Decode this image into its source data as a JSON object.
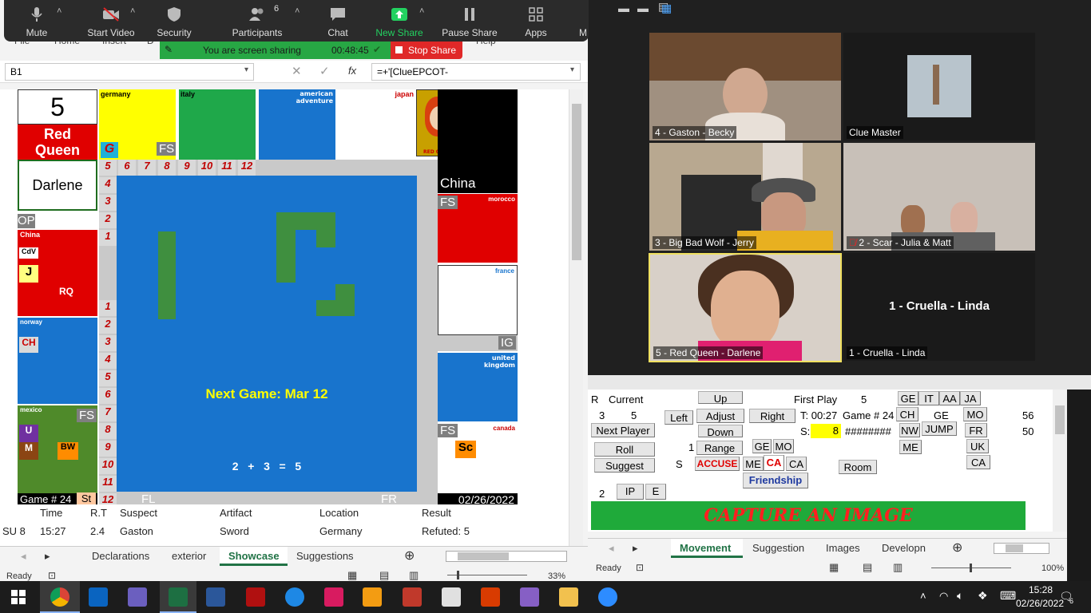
{
  "zoom_toolbar": {
    "buttons": [
      {
        "label": "Mute"
      },
      {
        "label": "Start Video"
      },
      {
        "label": "Security"
      },
      {
        "label": "Participants",
        "count": "6"
      },
      {
        "label": "Chat"
      },
      {
        "label": "New Share"
      },
      {
        "label": "Pause Share"
      },
      {
        "label": "Apps"
      },
      {
        "label": "M"
      }
    ],
    "sharing_text": "You are screen sharing",
    "sharing_time": "00:48:45",
    "stop_share": "Stop Share"
  },
  "excel_left": {
    "menu": [
      "File",
      "Home",
      "Insert",
      "D",
      "Help"
    ],
    "name_box": "B1",
    "formula": "=+'[ClueEPCOT-",
    "board": {
      "die_value": "5",
      "player_name_1": "Red",
      "player_name_2": "Queen",
      "darlene": "Darlene",
      "rooms": {
        "germany": "germany",
        "italy": "italy",
        "american_adventure_1": "american",
        "american_adventure_2": "adventure",
        "japan": "japan",
        "china": "China",
        "china_small": "China",
        "morocco": "morocco",
        "france": "france",
        "norway": "norway",
        "mexico": "mexico",
        "united_1": "united",
        "united_2": "kingdom",
        "canada": "canada"
      },
      "fs": "FS",
      "op": "OP",
      "ig": "IG",
      "fl": "FL",
      "fr": "FR",
      "st": "St",
      "cdv": "CdV",
      "j": "J",
      "rq": "RQ",
      "ch": "CH",
      "u": "U",
      "m": "M",
      "bw": "BW",
      "sc": "Sc",
      "g": "G",
      "top_nums": [
        "5",
        "6",
        "7",
        "8",
        "9",
        "10",
        "11",
        "12"
      ],
      "left_nums": [
        "4",
        "3",
        "2",
        "1",
        "",
        "",
        "1",
        "2",
        "3",
        "4",
        "5",
        "6",
        "7",
        "8",
        "9",
        "10",
        "11",
        "12"
      ],
      "next_game": "Next Game: Mar 12",
      "dice_sum": "2   +   3   =   5",
      "game_no": "Game # 24",
      "date": "02/26/2022",
      "card_caption": "RED QUEEN"
    },
    "table": {
      "headers": [
        "Time",
        "R.T",
        "Suspect",
        "Artifact",
        "Location",
        "Result"
      ],
      "row": [
        "SU 8",
        "15:27",
        "2.4",
        "Gaston",
        "Sword",
        "Germany",
        "Refuted: 5"
      ]
    },
    "tabs": [
      "Declarations",
      "exterior",
      "Showcase",
      "Suggestions"
    ],
    "active_tab": "Showcase",
    "status": "Ready",
    "zoom": "33%"
  },
  "zoom_gallery": {
    "tiles": [
      {
        "name": "4 - Gaston - Becky"
      },
      {
        "name": "Clue Master"
      },
      {
        "name": "3 - Big Bad Wolf - Jerry"
      },
      {
        "name": "2 - Scar - Julia & Matt"
      },
      {
        "name": "5 - Red Queen - Darlene"
      },
      {
        "name": "1 - Cruella - Linda",
        "center": "1 - Cruella - Linda"
      }
    ]
  },
  "excel_right": {
    "labels": {
      "r": "R",
      "current": "Current",
      "first_play": "First Play",
      "fp_val": "5",
      "v3": "3",
      "v5": "5",
      "t_label": "T: 00:27",
      "game": "Game # 24",
      "s_label": "S:",
      "s_val": "8",
      "hashes": "########",
      "n56": "56",
      "n50": "50",
      "one": "1",
      "s": "S",
      "two": "2",
      "ge_text": "GE"
    },
    "buttons": {
      "up": "Up",
      "left": "Left",
      "adjust": "Adjust",
      "right": "Right",
      "down": "Down",
      "next_player": "Next Player",
      "roll": "Roll",
      "range": "Range",
      "suggest": "Suggest",
      "accuse": "ACCUSE",
      "me": "ME",
      "ca": "CA",
      "ca2": "CA",
      "friendship": "Friendship",
      "room": "Room",
      "ge": "GE",
      "it": "IT",
      "aa": "AA",
      "ja": "JA",
      "ch": "CH",
      "mo": "MO",
      "nw": "NW",
      "jump": "JUMP",
      "fr": "FR",
      "me2": "ME",
      "uk": "UK",
      "ca3": "CA",
      "ge2": "GE",
      "mo2": "MO",
      "ip": "IP",
      "e": "E"
    },
    "capture": "CAPTURE AN IMAGE",
    "tabs": [
      "Movement",
      "Suggestion",
      "Images",
      "Developn"
    ],
    "active_tab": "Movement",
    "status": "Ready",
    "zoom": "100%"
  },
  "taskbar": {
    "time": "15:28",
    "date": "02/26/2022",
    "notif": "6"
  }
}
